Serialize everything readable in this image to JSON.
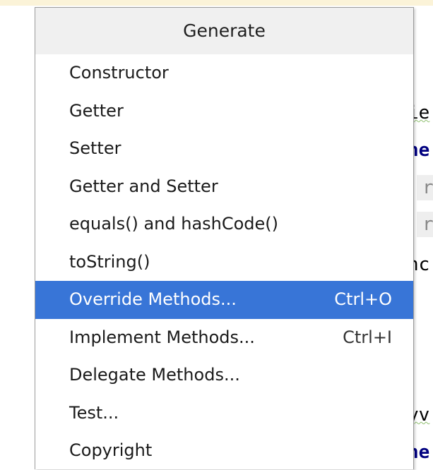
{
  "popup": {
    "title": "Generate",
    "items": [
      {
        "label": "Constructor",
        "shortcut": ""
      },
      {
        "label": "Getter",
        "shortcut": ""
      },
      {
        "label": "Setter",
        "shortcut": ""
      },
      {
        "label": "Getter and Setter",
        "shortcut": ""
      },
      {
        "label": "equals() and hashCode()",
        "shortcut": ""
      },
      {
        "label": "toString()",
        "shortcut": ""
      },
      {
        "label": "Override Methods...",
        "shortcut": "Ctrl+O"
      },
      {
        "label": "Implement Methods...",
        "shortcut": "Ctrl+I"
      },
      {
        "label": "Delegate Methods...",
        "shortcut": ""
      },
      {
        "label": "Test...",
        "shortcut": ""
      },
      {
        "label": "Copyright",
        "shortcut": ""
      }
    ]
  },
  "editor": {
    "fragments": [
      "ie",
      "ne",
      "r",
      "r",
      "nc",
      "yv",
      "ne"
    ]
  },
  "colors": {
    "selection": "#3875d7",
    "header_bg": "#f0f0f0",
    "top_strip": "#fbf3d8"
  }
}
